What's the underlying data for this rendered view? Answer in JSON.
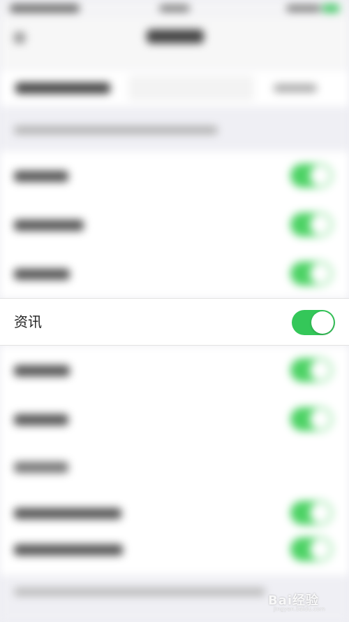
{
  "focused_row": {
    "label": "资讯",
    "toggle_on": true
  },
  "colors": {
    "toggle_on": "#34c759",
    "background": "#efeff4",
    "row": "#ffffff"
  },
  "icons": {
    "back": "chevron-left-icon",
    "watermark": "baidu-paw-logo"
  },
  "watermark": {
    "text": "Bai经验",
    "sub": "jingyan.baidu.com"
  }
}
